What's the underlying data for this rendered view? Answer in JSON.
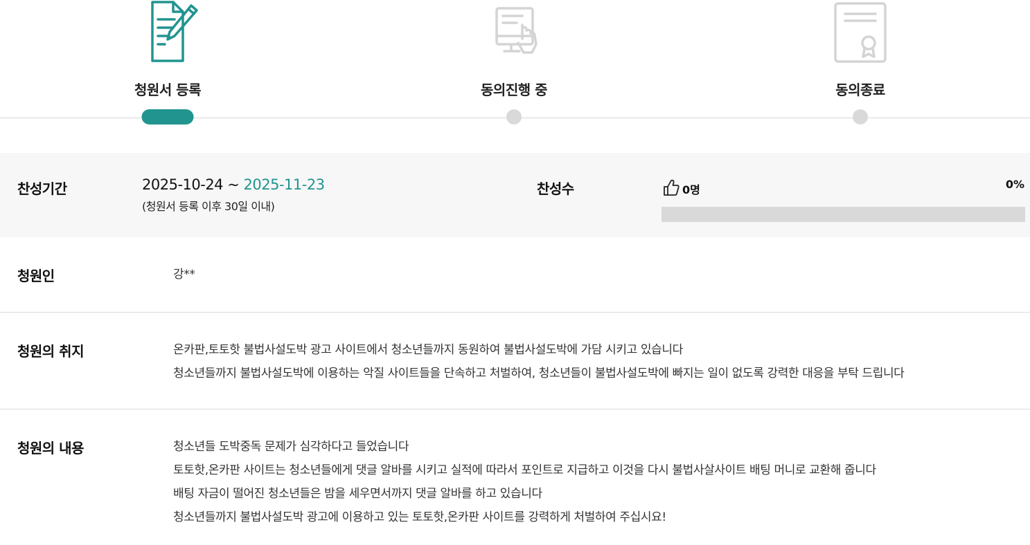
{
  "steps": [
    {
      "label": "청원서 등록",
      "icon": "document-pen-icon",
      "active": true
    },
    {
      "label": "동의진행 중",
      "icon": "computer-touch-icon",
      "active": false
    },
    {
      "label": "동의종료",
      "icon": "certificate-icon",
      "active": false
    }
  ],
  "colors": {
    "accent": "#21948f",
    "inactive": "#d9d9d9"
  },
  "period": {
    "label": "찬성기간",
    "start": "2025-10-24 ~",
    "end": "2025-11-23",
    "note": "(청원서 등록 이후 30일 이내)"
  },
  "support": {
    "label": "찬성수",
    "count": "0명",
    "percent_text": "0%",
    "progress": 0
  },
  "petitioner": {
    "label": "청원인",
    "name": "강**"
  },
  "purpose": {
    "label": "청원의 취지",
    "lines": [
      "온카판,토토핫 불법사설도박 광고 사이트에서 청소년들까지 동원하여 불법사설도박에 가담 시키고 있습니다",
      "청소년들까지 불법사설도박에 이용하는 악질 사이트들을  단속하고 처벌하여, 청소년들이 불법사설도박에 빠지는 일이 없도록 강력한 대응을 부탁 드립니다"
    ]
  },
  "body": {
    "label": "청원의 내용",
    "lines": [
      "청소년들 도박중독 문제가 심각하다고 들었습니다",
      "토토핫,온카판 사이트는 청소년들에게 댓글 알바를 시키고 실적에 따라서 포인트로 지급하고 이것을 다시 불법사살사이트 배팅 머니로 교환해 줍니다",
      "배팅 자금이 떨어진 청소년들은 밤을 세우면서까지 댓글 알바를 하고 있습니다",
      "청소년들까지 불법사설도박 광고에 이용하고 있는 토토핫,온카판 사이트를 강력하게 처벌하여 주십시요!"
    ]
  }
}
